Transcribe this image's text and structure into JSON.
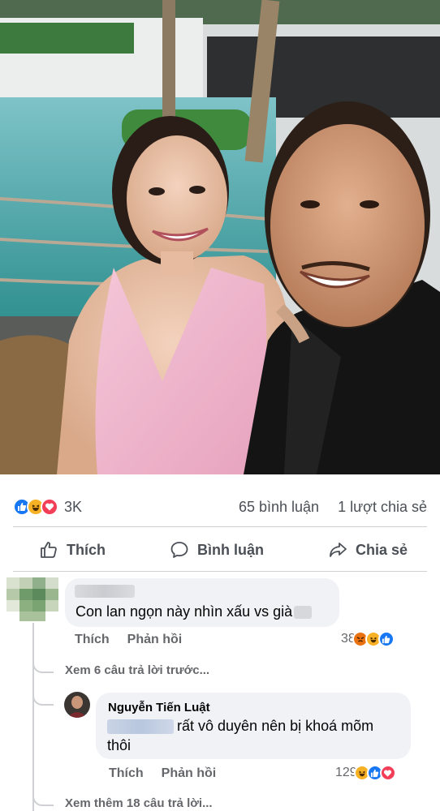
{
  "post": {
    "reactions": {
      "icons": [
        "like-icon",
        "haha-icon",
        "love-icon"
      ],
      "count": "3K"
    },
    "comments_count": "65 bình luận",
    "shares_count": "1 lượt chia sẻ",
    "actions": {
      "like": "Thích",
      "comment": "Bình luận",
      "share": "Chia sẻ"
    }
  },
  "comments": [
    {
      "author": "",
      "text": "Con lan ngọn này nhìn xấu vs già",
      "like_label": "Thích",
      "reply_label": "Phản hồi",
      "reaction_count": "38",
      "reaction_icons": [
        "angry-icon",
        "haha-icon",
        "like-icon"
      ]
    }
  ],
  "view_previous_replies": "Xem 6 câu trả lời trước...",
  "reply": {
    "author": "Nguyễn Tiến Luật",
    "text_line1": "rất vô duyên nên bị khoá mõm",
    "text_line2": "thôi",
    "like_label": "Thích",
    "reply_label": "Phản hồi",
    "reaction_count": "129",
    "reaction_icons": [
      "haha-icon",
      "like-icon",
      "love-icon"
    ]
  },
  "view_more_replies": "Xem thêm 18 câu trả lời...",
  "colors": {
    "like_blue": "#1877f2",
    "haha_yellow": "#f7b125",
    "love_red": "#f33e58",
    "angry_orange": "#e9710f",
    "meta_gray": "#65676b",
    "bubble_gray": "#f0f2f5"
  }
}
